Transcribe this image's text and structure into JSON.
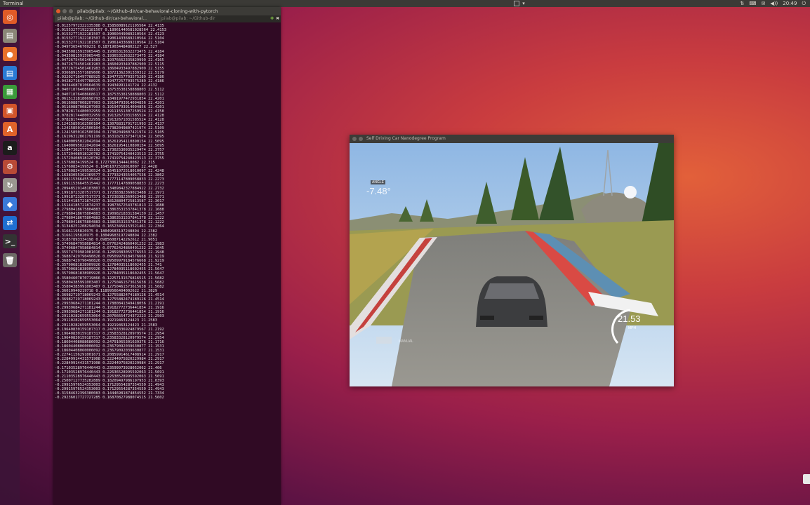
{
  "top_panel": {
    "app_name": "Terminal",
    "time": "20:49",
    "indicators": [
      "⇅",
      "⌨",
      "✉",
      "◀))",
      "⏻"
    ]
  },
  "launcher": {
    "items": [
      {
        "name": "ubuntu-logo-icon",
        "color": "#e05b27",
        "glyph": "◎"
      },
      {
        "name": "files-icon",
        "color": "#8a8677",
        "glyph": "▤"
      },
      {
        "name": "firefox-icon",
        "color": "#e8712a",
        "glyph": "●"
      },
      {
        "name": "writer-icon",
        "color": "#2a7bd4",
        "glyph": "▤"
      },
      {
        "name": "calc-icon",
        "color": "#3a9a3a",
        "glyph": "▦"
      },
      {
        "name": "impress-icon",
        "color": "#d2552a",
        "glyph": "▣"
      },
      {
        "name": "software-center-icon",
        "color": "#e0632a",
        "glyph": "A"
      },
      {
        "name": "amazon-icon",
        "color": "#1c1c1c",
        "glyph": "a"
      },
      {
        "name": "system-settings-icon",
        "color": "#b84a36",
        "glyph": "⚙"
      },
      {
        "name": "updater-icon",
        "color": "#9a9790",
        "glyph": "↻"
      },
      {
        "name": "pycharm-icon",
        "color": "#3a7ad9",
        "glyph": "◆"
      },
      {
        "name": "teamviewer-icon",
        "color": "#1f6fd1",
        "glyph": "⇄"
      },
      {
        "name": "terminal-icon",
        "color": "#333333",
        "glyph": ">_"
      },
      {
        "name": "trash-icon",
        "color": "#6d6b66",
        "glyph": "🗑"
      }
    ]
  },
  "terminal": {
    "title": "pilab@pilab: ~/Github-dir/car-behavioral-cloning-with-pytorch",
    "tabs": [
      "pilab@pilab: ~/Github-dir/car-behavioral...",
      "pilab@pilab: ~/Github-dir"
    ],
    "lines": [
      "-0.01257972322135388 0.15858089121195564 22.4135",
      "-0.015532771922181507 0.18961440581028564 22.4153",
      "-0.01532771922181507 0.19060449089210564 22.4123",
      "-0.01532771922181507 0.19061433689210564 22.5104",
      "-0.01532771922181507 0.19061433689210564 22.5104",
      "-0.049736546769231 0.18719034484802127 22.527",
      "-0.04350815915965445 0.19365313632273475 22.4184",
      "-0.04350815915965445 0.19365313632273475 22.4184",
      "-0.04726754501461983 0.19376662335829999 22.4165",
      "-0.04726754501461983 0.18604933497882909 22.5115",
      "-0.03726754501461983 0.18604933497882909 22.5155",
      "-0.03668915571689606 0.18721362301339312 22.5179",
      "-0.03202716497788925 0.19477257703575289 22.4186",
      "-0.04282716497788925 0.19477257703575289 22.4186",
      "-0.04344687810664639 0.19434991141724 22.4132",
      "-0.04071876408668617 0.18753538158888803 22.5112",
      "-0.04071876408668617 0.18753538158888803 22.5112",
      "-0.06151318186698793 0.18491977472931854 22.4201",
      "-0.06160887008207903 0.19194793914094856 22.4201",
      "-0.05160887008207903 0.19194793914094856 22.4201",
      "-0.07828174480032959 0.19111551307259524 22.4158",
      "-0.07828174480032959 0.19132671031585524 22.4128",
      "-0.07828174480032959 0.19132671031585524 22.4128",
      "-0.12415850162500104 0.13078831791721993 22.4137",
      "-0.12415850162500104 0.17382049807421974 22.5109",
      "-0.12415850162500104 0.17382049807421974 22.5105",
      "-0.16196312861791199 0.16310232373471634 22.5095",
      "-0.16400095022042694 0.16261954110890154 22.5095",
      "-0.16400095022042694 0.16261954110890154 22.5095",
      "-0.15847362577915192 0.17302530935229474 22.3757",
      "-0.15729408918120782 0.17419754240423513 22.3755",
      "-0.15729408918120782 0.17419754240423513 22.3755",
      "-0.15760834199524 0.17273061344410082 22.315",
      "-0.15760834199524 0.16451072518010097 22.4428",
      "-0.15760834199530524 0.16451072518010097 22.4248",
      "-0.16383055362369577 0.17733243554057536 22.3862",
      "-0.16911536645515442 0.17771147809058833 22.2273",
      "-0.16911536645515442 0.17771147809058833 22.2273",
      "-0.20948529148103807 0.13489842327884922 22.2732",
      "-0.19918723287517371 0.17238382369023488 22.1971",
      "-0.19918723287517371 0.17238382369023488 22.1971",
      "-0.15144185721874237 0.18128804725813587 22.3017",
      "-0.15144185721874237 0.19873672543781813 22.1688",
      "-0.27980418675804883 0.13863531537841378 22.1688",
      "-0.27980418675804883 0.19098218331384139 22.1457",
      "-0.27980418675804883 0.13863531537841378 22.1222",
      "-0.27980418675804883 0.13863531537841378 22.1222",
      "-0.31348251208294034 0.16523456153521461 22.2364",
      "-0.31661195826975 0.18049683197248894 22.2382",
      "-0.31661195826975 0.18049683197248894 22.2382",
      "-0.31857893334198 0.09856087142262612 21.9051",
      "-0.37496847958684814 0.07762424860491232 22.1983",
      "-0.37496847958684814 0.07762424860491232 22.1045",
      "-0.35574759981081016 0.12859383055776553 22.1948",
      "-0.36887429790490826 0.09509979184576668 21.9219",
      "-0.36887429790490826 0.09509979184576668 21.9219",
      "-0.35790681838909926 0.12784035118602455 21.741",
      "-0.35790681838909926 0.12784035118602455 21.5647",
      "-0.35790681838909926 0.12784035118602455 21.5647",
      "-0.35804607870719866 0.12257131576816515 21.5682",
      "-0.35804385991003407 0.12750461573615638 21.5682",
      "-0.35804385991003407 0.12750461573615638 21.5682",
      "-0.36010940219718 0.11899566404002622 21.3829",
      "-0.36982719718069243 0.12755882474189126 21.4514",
      "-0.36982719718069243 0.12755882474189126 21.4514",
      "-0.29939684271181244 0.17880841349418056 21.2191",
      "-0.29939684271181244 0.19182772736441854 21.1916",
      "-0.29939684271181244 0.19182772736441854 21.1916",
      "-0.29110282659553064 0.20766654724372223 21.2503",
      "-0.29110282659553064 0.19219463124423 21.2583",
      "-0.29110282659553064 0.19219463124423 21.2583",
      "-0.19640830159187317 0.24783336924879567 21.2192",
      "-0.19640830159187317 0.23583328120979574 21.2954",
      "-0.19640830159187317 0.23583328120979574 21.2954",
      "-0.18604408088686092 0.24791065301639376 21.1716",
      "-0.18604408060006092 0.23679092039630877 21.1531",
      "-0.18604408060006092 0.23679092039630877 21.1531",
      "-0.22741156291001671 0.20859914617408914 21.2917",
      "-0.22849914431571908 0.22244975820229984 21.2917",
      "-0.22849914431571908 0.22244975820229984 21.2917",
      "-0.17103528976440443 0.23599973928052062 21.406",
      "-0.17103528976440443 0.22636528995592063 21.5691",
      "-0.21103528976440443 0.22638528995592063 21.5691",
      "-0.25007127735282889 0.18209497986197953 21.0393",
      "-0.29915976524353003 0.17129554287354559 21.4943",
      "-0.29915976524353003 0.17129554287354559 21.4943",
      "-0.31584632396380083 0.14446981874854552 21.7334",
      "-0.29236017727727285 0.16870827988074515 21.5602"
    ]
  },
  "simulator": {
    "title": "Self Driving Car Nanodegree Program",
    "angle_label": "ANGLE",
    "angle_value": "-7.48°",
    "speed_value": "21.53",
    "speed_unit": "MPH",
    "mode_label": "MANUAL"
  }
}
